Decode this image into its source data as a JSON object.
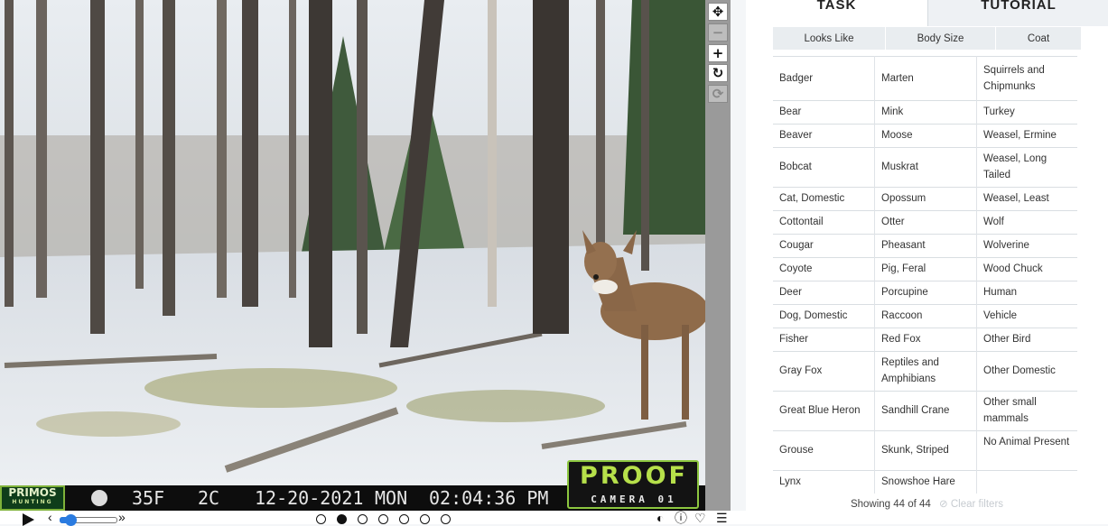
{
  "camera": {
    "temp_f": "35F",
    "temp_c": "2C",
    "date": "12-20-2021",
    "day": "MON",
    "time": "02:04:36 PM",
    "brand_logo": "PRIMOS",
    "brand_logo_sub": "HUNTING",
    "badge_main": "PROOF",
    "badge_sub": "CAMERA 01"
  },
  "zoom_tools": [
    "move-icon",
    "zoom-out-icon",
    "zoom-in-icon",
    "rotate-icon",
    "reset-icon"
  ],
  "playback": {
    "speed_low": "‹",
    "speed_high": "»",
    "speed_value": 0.2,
    "frames_total": 7,
    "frame_active": 1
  },
  "panel": {
    "tabs": {
      "task": "TASK",
      "tutorial": "TUTORIAL"
    },
    "filters": [
      "Looks Like",
      "Body Size",
      "Coat"
    ],
    "rows": [
      [
        "Badger",
        "Marten",
        "Squirrels and Chipmunks"
      ],
      [
        "Bear",
        "Mink",
        "Turkey"
      ],
      [
        "Beaver",
        "Moose",
        "Weasel, Ermine"
      ],
      [
        "Bobcat",
        "Muskrat",
        "Weasel, Long Tailed"
      ],
      [
        "Cat, Domestic",
        "Opossum",
        "Weasel, Least"
      ],
      [
        "Cottontail",
        "Otter",
        "Wolf"
      ],
      [
        "Cougar",
        "Pheasant",
        "Wolverine"
      ],
      [
        "Coyote",
        "Pig, Feral",
        "Wood Chuck"
      ],
      [
        "Deer",
        "Porcupine",
        "Human"
      ],
      [
        "Dog, Domestic",
        "Raccoon",
        "Vehicle"
      ],
      [
        "Fisher",
        "Red Fox",
        "Other Bird"
      ],
      [
        "Gray Fox",
        "Reptiles and Amphibians",
        "Other Domestic"
      ],
      [
        "Great Blue Heron",
        "Sandhill Crane",
        "Other small mammals"
      ],
      [
        "Grouse",
        "Skunk, Striped",
        "No Animal Present"
      ],
      [
        "Lynx",
        "Snowshoe Hare",
        ""
      ]
    ],
    "footer": {
      "showing": "Showing 44 of 44",
      "clear": "Clear filters"
    }
  },
  "colors": {
    "accent": "#2a7be0",
    "badge_green": "#8cc63f",
    "panel_bg": "#ffffff"
  }
}
